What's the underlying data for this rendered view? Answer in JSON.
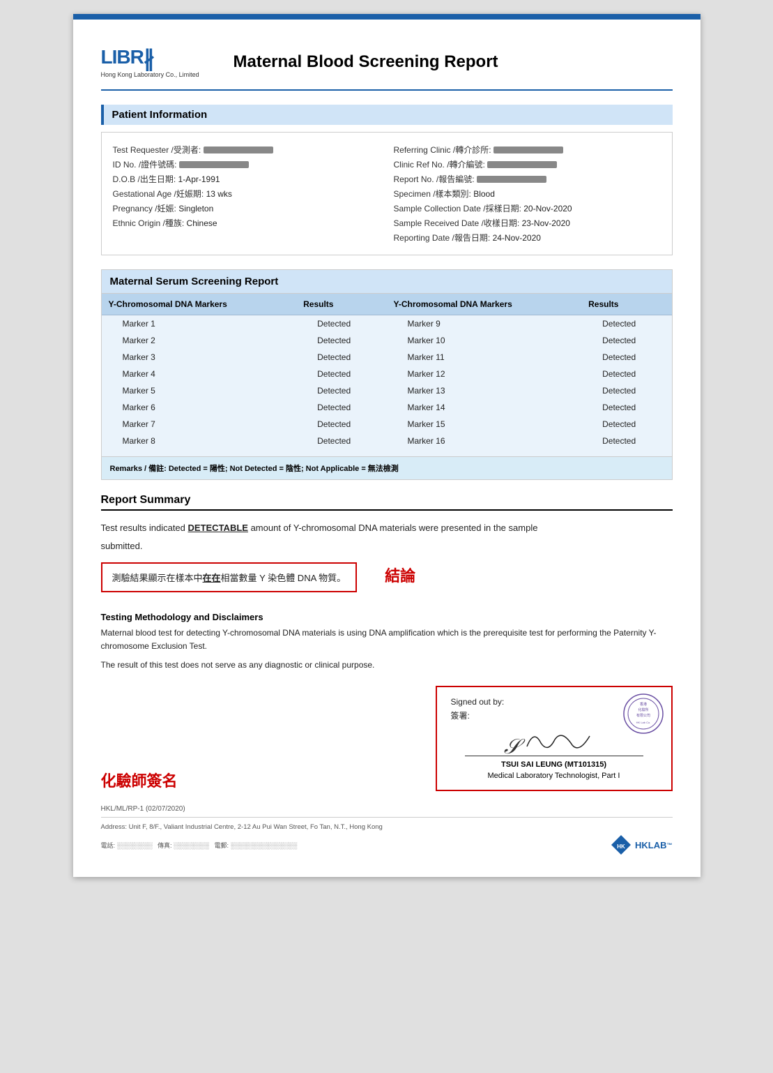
{
  "header": {
    "logo_text": "LIBRA",
    "logo_subtitle": "Hong Kong Laboratory Co., Limited",
    "report_title": "Maternal Blood Screening Report"
  },
  "patient_info": {
    "section_label": "Patient Information",
    "fields_left": [
      {
        "label": "Test Requester /受測者:",
        "value": "REDACTED"
      },
      {
        "label": "ID No. /證件號碼:",
        "value": "REDACTED"
      },
      {
        "label": "D.O.B /出生日期:",
        "value": "1-Apr-1991"
      },
      {
        "label": "Gestational Age /妊娠期:",
        "value": "13 wks"
      },
      {
        "label": "Pregnancy /妊娠:",
        "value": "Singleton"
      },
      {
        "label": "Ethnic Origin /種族:",
        "value": "Chinese"
      }
    ],
    "fields_right": [
      {
        "label": "Referring Clinic /轉介診所:",
        "value": "REDACTED"
      },
      {
        "label": "Clinic Ref No. /轉介編號:",
        "value": "REDACTED"
      },
      {
        "label": "Report No. /報告編號:",
        "value": "REDACTED"
      },
      {
        "label": "Specimen /樣本類別:",
        "value": "Blood"
      },
      {
        "label": "Sample Collection Date /採樣日期:",
        "value": "20-Nov-2020"
      },
      {
        "label": "Sample Received Date /收樣日期:",
        "value": "23-Nov-2020"
      },
      {
        "label": "Reporting Date /報告日期:",
        "value": "24-Nov-2020"
      }
    ]
  },
  "serum": {
    "section_label": "Maternal Serum Screening Report",
    "col1_header": "Y-Chromosomal DNA Markers",
    "col2_header": "Results",
    "col3_header": "Y-Chromosomal DNA Markers",
    "col4_header": "Results",
    "left_markers": [
      {
        "name": "Marker 1",
        "result": "Detected"
      },
      {
        "name": "Marker 2",
        "result": "Detected"
      },
      {
        "name": "Marker 3",
        "result": "Detected"
      },
      {
        "name": "Marker 4",
        "result": "Detected"
      },
      {
        "name": "Marker 5",
        "result": "Detected"
      },
      {
        "name": "Marker 6",
        "result": "Detected"
      },
      {
        "name": "Marker 7",
        "result": "Detected"
      },
      {
        "name": "Marker 8",
        "result": "Detected"
      }
    ],
    "right_markers": [
      {
        "name": "Marker 9",
        "result": "Detected"
      },
      {
        "name": "Marker 10",
        "result": "Detected"
      },
      {
        "name": "Marker 11",
        "result": "Detected"
      },
      {
        "name": "Marker 12",
        "result": "Detected"
      },
      {
        "name": "Marker 13",
        "result": "Detected"
      },
      {
        "name": "Marker 14",
        "result": "Detected"
      },
      {
        "name": "Marker 15",
        "result": "Detected"
      },
      {
        "name": "Marker 16",
        "result": "Detected"
      }
    ],
    "remarks": "Remarks / 備註: Detected = 陽性; Not Detected = 陰性; Not Applicable = 無法檢測"
  },
  "report_summary": {
    "section_label": "Report Summary",
    "summary_line1": "Test results indicated ",
    "summary_detectable": "DETECTABLE",
    "summary_line2": " amount of Y-chromosomal DNA materials were presented in the sample",
    "summary_submitted": "submitted.",
    "conclusion_cn": "測驗結果顯示在樣本中在在相當數量 Y 染色體 DNA 物質。",
    "conclusion_label": "結論"
  },
  "methodology": {
    "header": "Testing Methodology and Disclaimers",
    "text1": "Maternal blood test for detecting Y-chromosomal DNA materials is using DNA amplification which is the prerequisite test for performing the Paternity Y-chromosome Exclusion Test.",
    "text2": "The result of this test does not serve as any diagnostic or clinical purpose."
  },
  "signature": {
    "chemist_label": "化驗師簽名",
    "signed_out_label": "Signed out by:",
    "signed_out_cn": "簽署:",
    "signer_name": "TSUI SAI LEUNG (MT101315)",
    "signer_title": "Medical Laboratory Technologist, Part I"
  },
  "footer": {
    "ref": "HKL/ML/RP-1 (02/07/2020)",
    "address": "Address: Unit F, 8/F., Valiant Industrial Centre, 2-12 Au Pui Wan Street, Fo Tan, N.T., Hong Kong",
    "phones": "電話: [redacted]    傳真: [redacted]    電郵: [redacted]",
    "hklab": "HKLAB"
  }
}
